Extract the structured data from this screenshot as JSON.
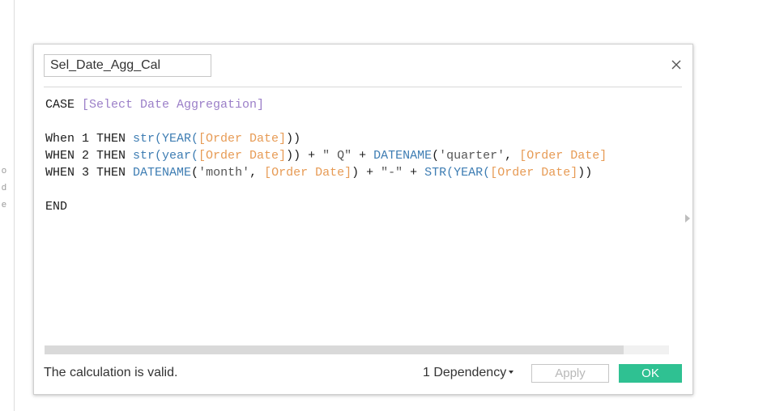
{
  "background": {
    "side_fragments": [
      "o",
      "d",
      "e"
    ]
  },
  "dialog": {
    "calc_name": "Sel_Date_Agg_Cal",
    "close_icon": "close-icon",
    "expand_icon": "triangle-right-icon",
    "code_lines": [
      [
        {
          "text": "CASE ",
          "type": "kw"
        },
        {
          "text": "[Select Date Aggregation]",
          "type": "param"
        }
      ],
      [],
      [
        {
          "text": "When 1 THEN ",
          "type": "kw"
        },
        {
          "text": "str(YEAR(",
          "type": "func"
        },
        {
          "text": "[Order Date]",
          "type": "field"
        },
        {
          "text": "))",
          "type": "punct"
        }
      ],
      [
        {
          "text": "WHEN 2 THEN ",
          "type": "kw"
        },
        {
          "text": "str(year(",
          "type": "func"
        },
        {
          "text": "[Order Date]",
          "type": "field"
        },
        {
          "text": ")) + ",
          "type": "punct"
        },
        {
          "text": "\" Q\"",
          "type": "str"
        },
        {
          "text": " + ",
          "type": "punct"
        },
        {
          "text": "DATENAME",
          "type": "func"
        },
        {
          "text": "(",
          "type": "punct"
        },
        {
          "text": "'quarter'",
          "type": "str"
        },
        {
          "text": ", ",
          "type": "punct"
        },
        {
          "text": "[Order Date]",
          "type": "field"
        }
      ],
      [
        {
          "text": "WHEN 3 THEN ",
          "type": "kw"
        },
        {
          "text": "DATENAME",
          "type": "func"
        },
        {
          "text": "(",
          "type": "punct"
        },
        {
          "text": "'month'",
          "type": "str"
        },
        {
          "text": ", ",
          "type": "punct"
        },
        {
          "text": "[Order Date]",
          "type": "field"
        },
        {
          "text": ") + ",
          "type": "punct"
        },
        {
          "text": "\"-\"",
          "type": "str"
        },
        {
          "text": " + ",
          "type": "punct"
        },
        {
          "text": "STR(YEAR(",
          "type": "func"
        },
        {
          "text": "[Order Date]",
          "type": "field"
        },
        {
          "text": "))",
          "type": "punct"
        }
      ],
      [],
      [
        {
          "text": "END",
          "type": "kw"
        }
      ]
    ],
    "status_text": "The calculation is valid.",
    "dependency_label": "1 Dependency",
    "apply_label": "Apply",
    "ok_label": "OK"
  },
  "colors": {
    "ok_button": "#2fc192",
    "param_token": "#9b7fc8",
    "field_token": "#e79b55",
    "function_token": "#3e7db3"
  }
}
